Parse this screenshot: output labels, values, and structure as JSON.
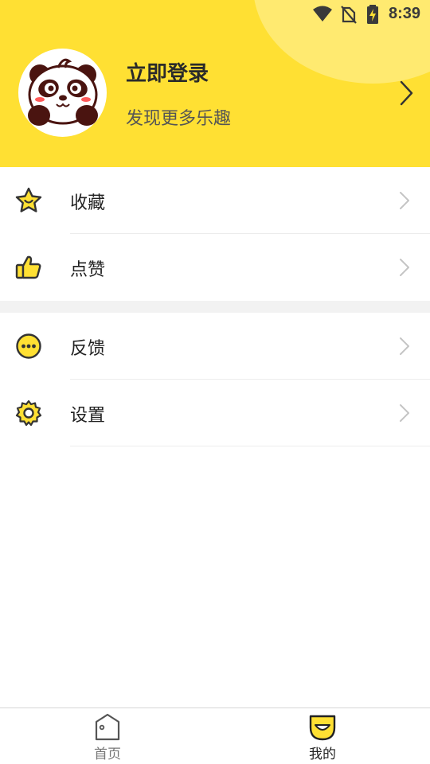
{
  "status_bar": {
    "time": "8:39"
  },
  "profile": {
    "title": "立即登录",
    "subtitle": "发现更多乐趣"
  },
  "menu": [
    {
      "label": "收藏",
      "icon": "star-icon"
    },
    {
      "label": "点赞",
      "icon": "thumbs-up-icon"
    },
    {
      "label": "反馈",
      "icon": "feedback-dots-icon"
    },
    {
      "label": "设置",
      "icon": "gear-icon"
    }
  ],
  "bottom_nav": [
    {
      "label": "首页",
      "icon": "home-icon",
      "active": false
    },
    {
      "label": "我的",
      "icon": "smile-icon",
      "active": true
    }
  ],
  "colors": {
    "accent": "#FFE033",
    "icon_stroke": "#333333"
  }
}
